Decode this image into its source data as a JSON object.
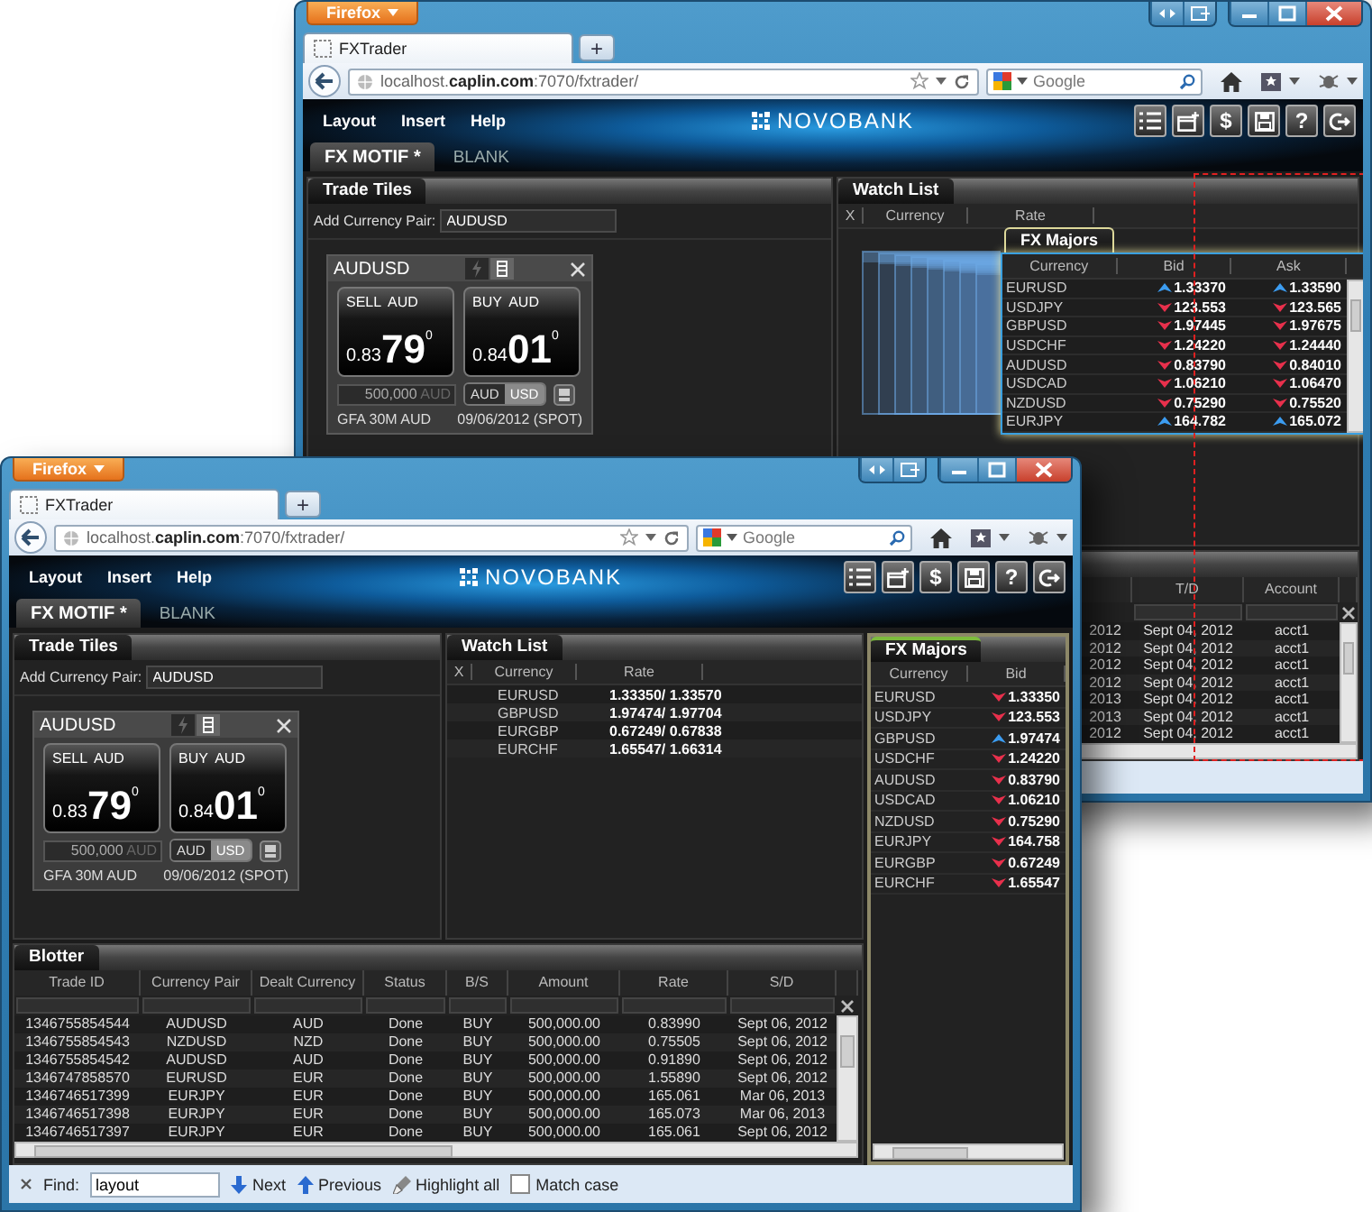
{
  "back_window": {
    "firefox_button": "Firefox",
    "tab": {
      "title": "FXTrader"
    },
    "new_tab": "+",
    "address": "localhost.**caplin.com**:7070/fxtrader/",
    "search": {
      "placeholder": "Google"
    },
    "menu": [
      "Layout",
      "Insert",
      "Help"
    ],
    "brand": "NOVOBANK",
    "toolbar": [
      {
        "kind": "list"
      },
      {
        "kind": "add-window"
      },
      {
        "kind": "glyph",
        "glyph": "$"
      },
      {
        "kind": "save"
      },
      {
        "kind": "glyph",
        "glyph": "?"
      },
      {
        "kind": "exit"
      }
    ],
    "tabs": [
      {
        "label": "FX MOTIF *",
        "selected": true
      },
      {
        "label": "BLANK",
        "selected": false
      }
    ],
    "trade_tiles": {
      "title": "Trade Tiles",
      "add_label": "Add Currency Pair:",
      "add_value": "AUDUSD",
      "tile": {
        "pair": "AUDUSD",
        "sell": {
          "label": "SELL AUD",
          "prefix": "0.83",
          "big": "79",
          "pip": "0"
        },
        "buy": {
          "label": "BUY AUD",
          "prefix": "0.84",
          "big": "01",
          "pip": "0"
        },
        "amount": "500,000",
        "amount_currency": "AUD",
        "currencies": [
          {
            "label": "AUD",
            "selected": false
          },
          {
            "label": "USD",
            "selected": true
          }
        ],
        "info": "GFA 30M AUD",
        "date": "09/06/2012 (SPOT)"
      }
    },
    "watch_list": {
      "title": "Watch List",
      "columns": [
        "X",
        "Currency",
        "Rate"
      ]
    },
    "fx_majors": {
      "title": "FX Majors",
      "columns": [
        "Currency",
        "Bid",
        "Ask"
      ],
      "rows": [
        {
          "pair": "EURUSD",
          "bid": "1.33370",
          "bid_up": true,
          "ask": "1.33590",
          "ask_up": true
        },
        {
          "pair": "USDJPY",
          "bid": "123.553",
          "bid_up": false,
          "ask": "123.565",
          "ask_up": false
        },
        {
          "pair": "GBPUSD",
          "bid": "1.97445",
          "bid_up": false,
          "ask": "1.97675",
          "ask_up": false
        },
        {
          "pair": "USDCHF",
          "bid": "1.24220",
          "bid_up": false,
          "ask": "1.24440",
          "ask_up": false
        },
        {
          "pair": "AUDUSD",
          "bid": "0.83790",
          "bid_up": false,
          "ask": "0.84010",
          "ask_up": false
        },
        {
          "pair": "USDCAD",
          "bid": "1.06210",
          "bid_up": false,
          "ask": "1.06470",
          "ask_up": false
        },
        {
          "pair": "NZDUSD",
          "bid": "0.75290",
          "bid_up": false,
          "ask": "0.75520",
          "ask_up": false
        },
        {
          "pair": "EURJPY",
          "bid": "164.782",
          "bid_up": true,
          "ask": "165.072",
          "ask_up": true
        }
      ]
    },
    "blotter": {
      "columns": [
        "T/D",
        "Account"
      ],
      "rows": [
        {
          "column_1": "2012",
          "td": "Sept 04, 2012",
          "account": "acct1"
        },
        {
          "column_1": "2012",
          "td": "Sept 04, 2012",
          "account": "acct1"
        },
        {
          "column_1": "2012",
          "td": "Sept 04, 2012",
          "account": "acct1"
        },
        {
          "column_1": "2012",
          "td": "Sept 04, 2012",
          "account": "acct1"
        },
        {
          "column_1": "2013",
          "td": "Sept 04, 2012",
          "account": "acct1"
        },
        {
          "column_1": "2013",
          "td": "Sept 04, 2012",
          "account": "acct1"
        },
        {
          "column_1": "2012",
          "td": "Sept 04, 2012",
          "account": "acct1"
        }
      ]
    }
  },
  "front_window": {
    "firefox_button": "Firefox",
    "tab": {
      "title": "FXTrader"
    },
    "new_tab": "+",
    "address": "localhost.**caplin.com**:7070/fxtrader/",
    "search": {
      "placeholder": "Google"
    },
    "menu": [
      "Layout",
      "Insert",
      "Help"
    ],
    "brand": "NOVOBANK",
    "toolbar": [
      {
        "kind": "list"
      },
      {
        "kind": "add-window"
      },
      {
        "kind": "glyph",
        "glyph": "$"
      },
      {
        "kind": "save"
      },
      {
        "kind": "glyph",
        "glyph": "?"
      },
      {
        "kind": "exit"
      }
    ],
    "tabs": [
      {
        "label": "FX MOTIF *",
        "selected": true
      },
      {
        "label": "BLANK",
        "selected": false
      }
    ],
    "trade_tiles": {
      "title": "Trade Tiles",
      "add_label": "Add Currency Pair:",
      "add_value": "AUDUSD",
      "tile": {
        "pair": "AUDUSD",
        "sell": {
          "label": "SELL AUD",
          "prefix": "0.83",
          "big": "79",
          "pip": "0"
        },
        "buy": {
          "label": "BUY AUD",
          "prefix": "0.84",
          "big": "01",
          "pip": "0"
        },
        "amount": "500,000",
        "amount_currency": "AUD",
        "currencies": [
          {
            "label": "AUD",
            "selected": false
          },
          {
            "label": "USD",
            "selected": true
          }
        ],
        "info": "GFA 30M AUD",
        "date": "09/06/2012 (SPOT)"
      }
    },
    "watch_list": {
      "title": "Watch List",
      "columns": [
        "X",
        "Currency",
        "Rate"
      ],
      "rows": [
        {
          "pair": "EURUSD",
          "rate": "1.33350/ 1.33570"
        },
        {
          "pair": "GBPUSD",
          "rate": "1.97474/ 1.97704"
        },
        {
          "pair": "EURGBP",
          "rate": "0.67249/ 0.67838"
        },
        {
          "pair": "EURCHF",
          "rate": "1.65547/ 1.66314"
        }
      ]
    },
    "fx_majors": {
      "title": "FX Majors",
      "columns": [
        "Currency",
        "Bid"
      ],
      "rows": [
        {
          "pair": "EURUSD",
          "bid": "1.33350",
          "bid_up": false
        },
        {
          "pair": "USDJPY",
          "bid": "123.553",
          "bid_up": false
        },
        {
          "pair": "GBPUSD",
          "bid": "1.97474",
          "bid_up": true
        },
        {
          "pair": "USDCHF",
          "bid": "1.24220",
          "bid_up": false
        },
        {
          "pair": "AUDUSD",
          "bid": "0.83790",
          "bid_up": false
        },
        {
          "pair": "USDCAD",
          "bid": "1.06210",
          "bid_up": false
        },
        {
          "pair": "NZDUSD",
          "bid": "0.75290",
          "bid_up": false
        },
        {
          "pair": "EURJPY",
          "bid": "164.758",
          "bid_up": false
        },
        {
          "pair": "EURGBP",
          "bid": "0.67249",
          "bid_up": false
        },
        {
          "pair": "EURCHF",
          "bid": "1.65547",
          "bid_up": false
        }
      ]
    },
    "blotter": {
      "title": "Blotter",
      "columns": [
        "Trade ID",
        "Currency Pair",
        "Dealt Currency",
        "Status",
        "B/S",
        "Amount",
        "Rate",
        "S/D"
      ],
      "rows": [
        [
          "1346755854544",
          "AUDUSD",
          "AUD",
          "Done",
          "BUY",
          "500,000.00",
          "0.83990",
          "Sept 06, 2012"
        ],
        [
          "1346755854543",
          "NZDUSD",
          "NZD",
          "Done",
          "BUY",
          "500,000.00",
          "0.75505",
          "Sept 06, 2012"
        ],
        [
          "1346755854542",
          "AUDUSD",
          "AUD",
          "Done",
          "BUY",
          "500,000.00",
          "0.91890",
          "Sept 06, 2012"
        ],
        [
          "1346747858570",
          "EURUSD",
          "EUR",
          "Done",
          "BUY",
          "500,000.00",
          "1.55890",
          "Sept 06, 2012"
        ],
        [
          "1346746517399",
          "EURJPY",
          "EUR",
          "Done",
          "BUY",
          "500,000.00",
          "165.061",
          "Mar 06, 2013"
        ],
        [
          "1346746517398",
          "EURJPY",
          "EUR",
          "Done",
          "BUY",
          "500,000.00",
          "165.073",
          "Mar 06, 2013"
        ],
        [
          "1346746517397",
          "EURJPY",
          "EUR",
          "Done",
          "BUY",
          "500,000.00",
          "165.061",
          "Sept 06, 2012"
        ]
      ]
    },
    "find_bar": {
      "label": "Find:",
      "value": "layout",
      "next": "Next",
      "previous": "Previous",
      "highlight": "Highlight all",
      "match_case": {
        "label": "Match case",
        "checked": false
      }
    }
  }
}
